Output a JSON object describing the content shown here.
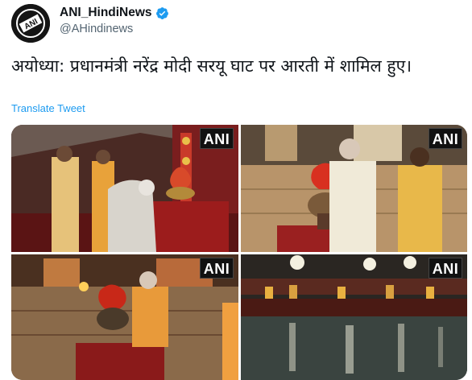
{
  "account": {
    "display_name": "ANI_HindiNews",
    "handle": "@AHindinews",
    "avatar_icon": "ani-logo-icon",
    "verified_icon": "verified-badge-icon"
  },
  "tweet": {
    "text": "अयोध्या: प्रधानमंत्री नरेंद्र मोदी सरयू घाट पर आरती में शामिल हुए।",
    "translate_label": "Translate Tweet"
  },
  "media": {
    "watermark": "ANI",
    "tiles": [
      {
        "watermark": "ANI"
      },
      {
        "watermark": "ANI"
      },
      {
        "watermark": "ANI"
      },
      {
        "watermark": "ANI"
      }
    ]
  },
  "colors": {
    "link": "#1d9bf0",
    "secondary_text": "#536471",
    "verified": "#1d9bf0"
  }
}
